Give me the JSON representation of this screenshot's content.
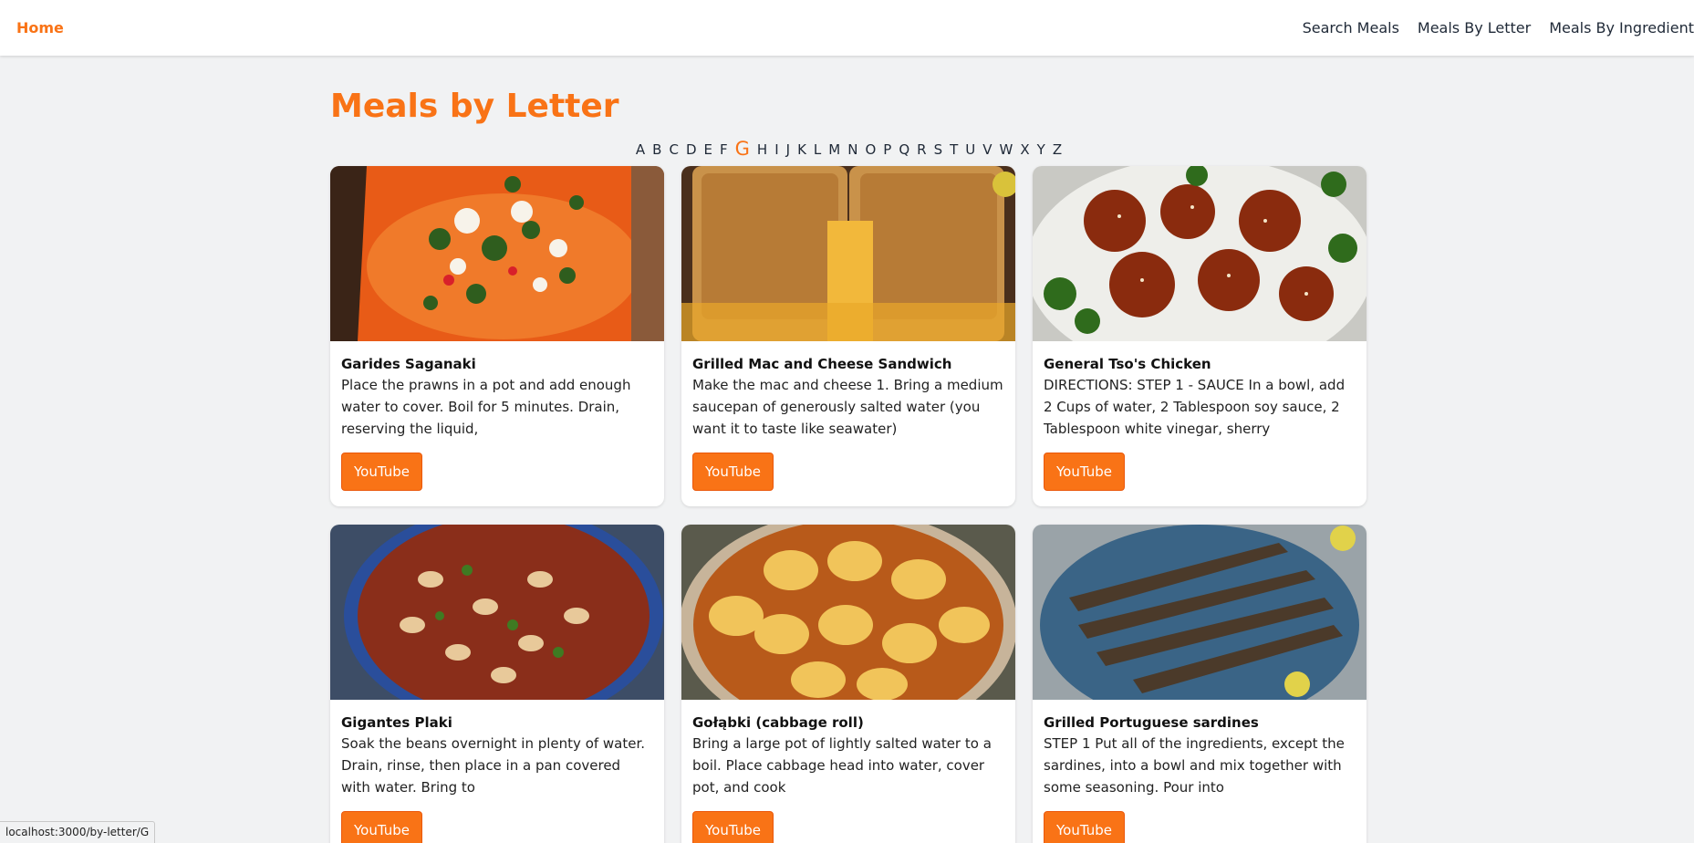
{
  "header": {
    "home": "Home",
    "nav": [
      "Search Meals",
      "Meals By Letter",
      "Meals By Ingredient"
    ]
  },
  "page": {
    "title": "Meals by Letter",
    "letters": [
      "A",
      "B",
      "C",
      "D",
      "E",
      "F",
      "G",
      "H",
      "I",
      "J",
      "K",
      "L",
      "M",
      "N",
      "O",
      "P",
      "Q",
      "R",
      "S",
      "T",
      "U",
      "V",
      "W",
      "X",
      "Y",
      "Z"
    ],
    "active_letter": "G"
  },
  "meals": [
    {
      "title": "Garides Saganaki",
      "desc": "Place the prawns in a pot and add enough water to cover. Boil for 5 minutes. Drain, reserving the liquid,",
      "button": "YouTube"
    },
    {
      "title": "Grilled Mac and Cheese Sandwich",
      "desc": "Make the mac and cheese 1. Bring a medium saucepan of generously salted water (you want it to taste like seawater)",
      "button": "YouTube"
    },
    {
      "title": "General Tso's Chicken",
      "desc": "DIRECTIONS: STEP 1 - SAUCE In a bowl, add 2 Cups of water, 2 Tablespoon soy sauce, 2 Tablespoon white vinegar, sherry",
      "button": "YouTube"
    },
    {
      "title": "Gigantes Plaki",
      "desc": "Soak the beans overnight in plenty of water. Drain, rinse, then place in a pan covered with water. Bring to",
      "button": "YouTube"
    },
    {
      "title": "Gołąbki (cabbage roll)",
      "desc": "Bring a large pot of lightly salted water to a boil. Place cabbage head into water, cover pot, and cook",
      "button": "YouTube"
    },
    {
      "title": "Grilled Portuguese sardines",
      "desc": "STEP 1 Put all of the ingredients, except the sardines, into a bowl and mix together with some seasoning. Pour into",
      "button": "YouTube"
    }
  ],
  "status": "localhost:3000/by-letter/G",
  "colors": {
    "accent": "#f97316",
    "background": "#f1f2f3"
  }
}
